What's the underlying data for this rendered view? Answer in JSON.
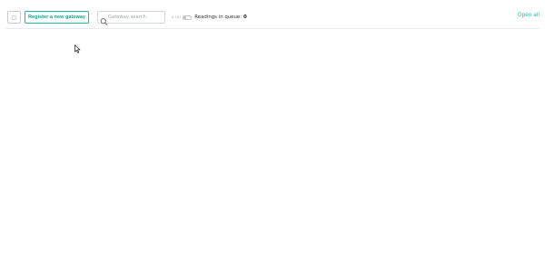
{
  "toolbar": {
    "register_label": "Register a new gateway",
    "search": {
      "placeholder": "Gateway search",
      "value": ""
    },
    "queue": {
      "toggle_label": "0.161",
      "readings_label": "Readings in queue:",
      "readings_count": "0"
    },
    "open_all_label": "Open all"
  },
  "colors": {
    "accent": "#1abc9c",
    "border": "#d6d9dc",
    "divider": "#e9ecef"
  },
  "icons": {
    "search": "search-icon",
    "cursor": "mouse-cursor-icon"
  }
}
